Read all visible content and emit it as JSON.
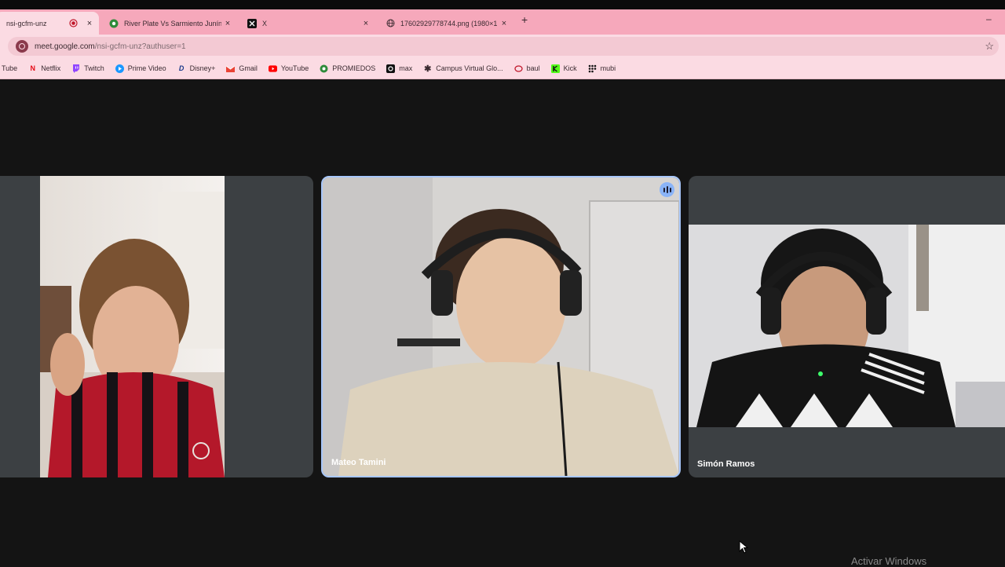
{
  "browser": {
    "tabs": [
      {
        "label": "nsi-gcfm-unz",
        "icon": "recording-icon",
        "active": true
      },
      {
        "label": "River Plate Vs Sarmiento Junín",
        "icon": "soccer-ball-icon",
        "active": false
      },
      {
        "label": "X",
        "icon": "x-logo-icon",
        "active": false
      },
      {
        "label": "17602929778744.png (1980×1",
        "icon": "globe-icon",
        "active": false
      }
    ],
    "new_tab": "+",
    "close_glyph": "×",
    "minimize": "–",
    "url": {
      "host": "meet.google.com",
      "path": "/nsi-gcfm-unz?authuser=1"
    },
    "bookmarks": [
      {
        "label": "Tube",
        "icon": ""
      },
      {
        "label": "Netflix",
        "icon": "netflix-icon"
      },
      {
        "label": "Twitch",
        "icon": "twitch-icon"
      },
      {
        "label": "Prime Video",
        "icon": "prime-video-icon"
      },
      {
        "label": "Disney+",
        "icon": "disney-icon"
      },
      {
        "label": "Gmail",
        "icon": "gmail-icon"
      },
      {
        "label": "YouTube",
        "icon": "youtube-icon"
      },
      {
        "label": "PROMIEDOS",
        "icon": "soccer-ball-icon"
      },
      {
        "label": "max",
        "icon": "max-icon"
      },
      {
        "label": "Campus Virtual Glo...",
        "icon": "campus-icon"
      },
      {
        "label": "baul",
        "icon": "baul-icon"
      },
      {
        "label": "Kick",
        "icon": "kick-icon"
      },
      {
        "label": "mubi",
        "icon": "mubi-icon"
      }
    ]
  },
  "meet": {
    "participants": [
      {
        "name": "",
        "shirt": "#c0182b"
      },
      {
        "name": "Mateo Tamini",
        "speaking": true
      },
      {
        "name": "Simón Ramos"
      }
    ]
  },
  "watermark": "Activar Windows"
}
